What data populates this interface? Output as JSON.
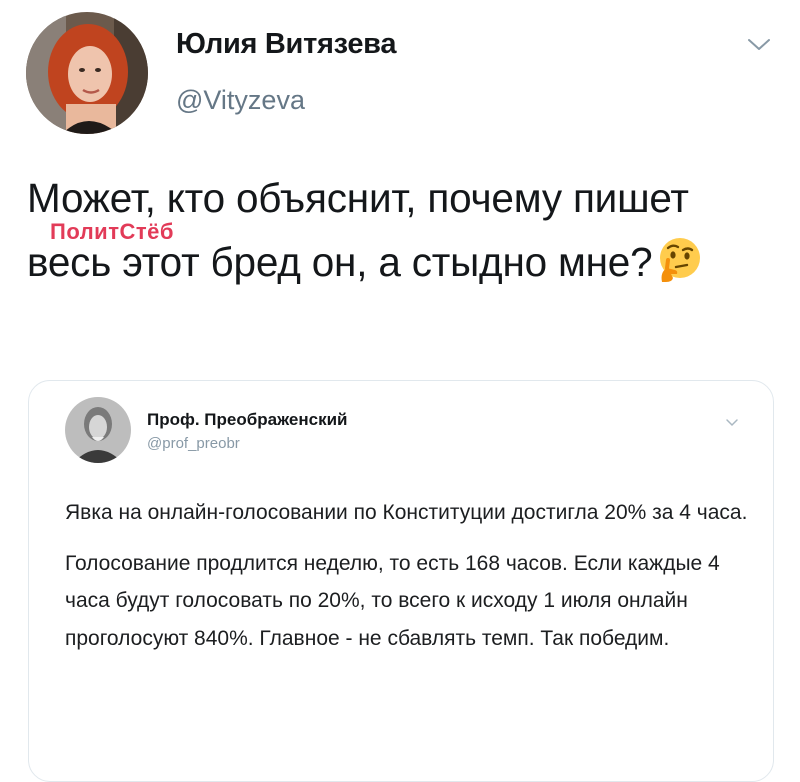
{
  "author": {
    "display_name": "Юлия Витязева",
    "handle": "@Vityzeva"
  },
  "tweet": {
    "text": "Может, кто объяснит, почему пишет весь этот бред он, а стыдно мне?",
    "emoji": "thinking-face-icon"
  },
  "watermark": "ПолитСтёб",
  "quoted": {
    "display_name": "Проф. Преображенский",
    "handle": "@prof_preobr",
    "paragraphs": [
      "Явка на онлайн-голосовании по Конституции достигла 20% за 4 часа.",
      "Голосование продлится неделю, то есть 168 часов. Если каждые 4 часа будут голосовать по 20%, то всего к исходу 1 июля онлайн проголосуют 840%. Главное - не сбавлять темп. Так победим."
    ]
  },
  "colors": {
    "text": "#14171a",
    "secondary": "#657786",
    "border": "#e1e8ed",
    "watermark": "#e23b58"
  }
}
